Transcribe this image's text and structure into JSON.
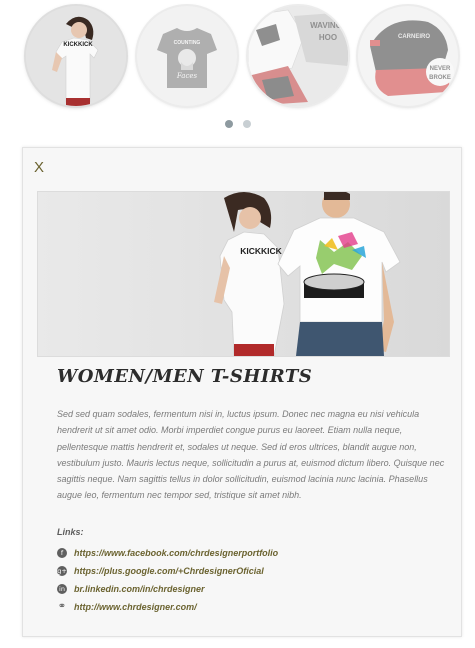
{
  "carousel": {
    "items": [
      {
        "icon": "women-tshirt-thumbnail",
        "active": true
      },
      {
        "icon": "grey-tshirt-thumbnail",
        "active": false
      },
      {
        "icon": "hoodie-tshirt-thumbnail",
        "active": false
      },
      {
        "icon": "cap-thumbnail",
        "active": false
      }
    ],
    "pages": 2,
    "current_page": 1
  },
  "detail": {
    "close_label": "X",
    "image_icon": "couple-tshirts-photo",
    "image_text": "KICKKICK",
    "title": "WOMEN/MEN T-SHIRTS",
    "description": "Sed sed quam sodales, fermentum nisi in, luctus ipsum. Donec nec magna eu nisi vehicula hendrerit ut sit amet odio. Morbi imperdiet congue purus eu laoreet. Etiam nulla neque, pellentesque mattis hendrerit et, sodales ut neque. Sed id eros ultrices, blandit augue non, vestibulum justo. Mauris lectus neque, sollicitudin a purus at, euismod dictum libero. Quisque nec sagittis neque. Nam sagittis tellus in dolor sollicitudin, euismod lacinia nunc lacinia. Phasellus augue leo, fermentum nec tempor sed, tristique sit amet nibh.",
    "links_label": "Links:",
    "links": [
      {
        "icon": "facebook-icon",
        "text": "https://www.facebook.com/chrdesignerportfolio"
      },
      {
        "icon": "google-plus-icon",
        "text": "https://plus.google.com/+ChrdesignerOficial"
      },
      {
        "icon": "linkedin-icon",
        "text": "br.linkedin.com/in/chrdesigner"
      },
      {
        "icon": "link-icon",
        "text": "http://www.chrdesigner.com/"
      }
    ]
  },
  "colors": {
    "link": "#6b6330",
    "title": "#2c2c2c",
    "body_text": "#7a7a7a",
    "dot_active": "#8e9aa0",
    "dot_inactive": "#c8cfd3"
  }
}
